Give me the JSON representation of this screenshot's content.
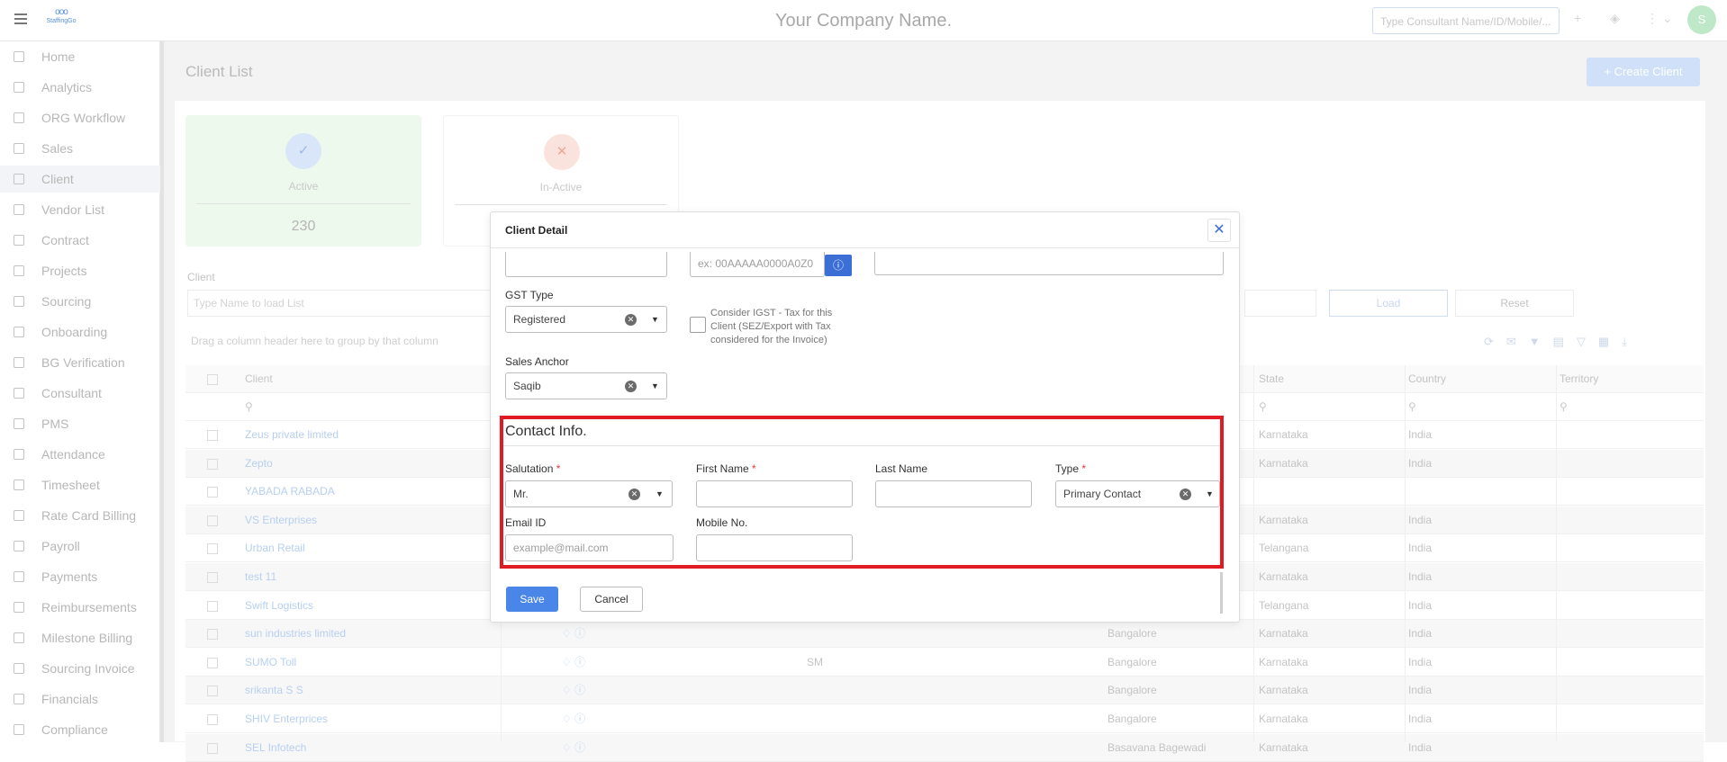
{
  "header": {
    "company_name": "Your Company Name.",
    "search_placeholder": "Type Consultant Name/ID/Mobile/...",
    "avatar_initial": "S",
    "logo_text": "StaffingGo"
  },
  "sidebar": {
    "items": [
      {
        "label": "Home"
      },
      {
        "label": "Analytics"
      },
      {
        "label": "ORG Workflow"
      },
      {
        "label": "Sales"
      },
      {
        "label": "Client"
      },
      {
        "label": "Vendor List"
      },
      {
        "label": "Contract"
      },
      {
        "label": "Projects"
      },
      {
        "label": "Sourcing"
      },
      {
        "label": "Onboarding"
      },
      {
        "label": "BG Verification"
      },
      {
        "label": "Consultant"
      },
      {
        "label": "PMS"
      },
      {
        "label": "Attendance"
      },
      {
        "label": "Timesheet"
      },
      {
        "label": "Rate Card Billing"
      },
      {
        "label": "Payroll"
      },
      {
        "label": "Payments"
      },
      {
        "label": "Reimbursements"
      },
      {
        "label": "Milestone Billing"
      },
      {
        "label": "Sourcing Invoice"
      },
      {
        "label": "Financials"
      },
      {
        "label": "Compliance"
      }
    ],
    "active": "Client"
  },
  "page": {
    "title": "Client List",
    "create_button": "+ Create Client",
    "active_card": {
      "label": "Active",
      "count": "230"
    },
    "inactive_card": {
      "label": "In-Active",
      "count": ""
    },
    "client_filter_label": "Client",
    "client_filter_placeholder": "Type Name to load List",
    "load_button": "Load",
    "reset_button": "Reset",
    "group_hint": "Drag a column header here to group by that column"
  },
  "grid": {
    "headers": {
      "client": "Client",
      "state": "State",
      "country": "Country",
      "territory": "Territory"
    },
    "rows": [
      {
        "client": "Zeus private limited",
        "code": "",
        "city": "",
        "state": "Karnataka",
        "country": "India"
      },
      {
        "client": "Zepto",
        "code": "",
        "city": "",
        "state": "Karnataka",
        "country": "India"
      },
      {
        "client": "YABADA RABADA",
        "code": "",
        "city": "",
        "state": "",
        "country": ""
      },
      {
        "client": "VS Enterprises",
        "code": "",
        "city": "",
        "state": "Karnataka",
        "country": "India"
      },
      {
        "client": "Urban Retail",
        "code": "",
        "city": "",
        "state": "Telangana",
        "country": "India"
      },
      {
        "client": "test 11",
        "code": "",
        "city": "",
        "state": "Karnataka",
        "country": "India"
      },
      {
        "client": "Swift Logistics",
        "code": "",
        "city": "",
        "state": "Telangana",
        "country": "India"
      },
      {
        "client": "sun industries limited",
        "code": "",
        "city": "Bangalore",
        "state": "Karnataka",
        "country": "India"
      },
      {
        "client": "SUMO Toll",
        "code": "SM",
        "city": "Bangalore",
        "state": "Karnataka",
        "country": "India"
      },
      {
        "client": "srikanta S S",
        "code": "",
        "city": "Bangalore",
        "state": "Karnataka",
        "country": "India"
      },
      {
        "client": "SHIV Enterprices",
        "code": "",
        "city": "Bangalore",
        "state": "Karnataka",
        "country": "India"
      },
      {
        "client": "SEL Infotech",
        "code": "",
        "city": "Basavana Bagewadi",
        "state": "Karnataka",
        "country": "India"
      }
    ]
  },
  "modal": {
    "title": "Client Detail",
    "gstin_placeholder": "ex: 00AAAAA0000A0Z0",
    "gst_type_label": "GST Type",
    "gst_type_value": "Registered",
    "igst_text": "Consider IGST - Tax for this Client (SEZ/Export with Tax considered for the Invoice)",
    "sales_anchor_label": "Sales Anchor",
    "sales_anchor_value": "Saqib",
    "contact_section_title": "Contact Info.",
    "salutation_label": "Salutation",
    "salutation_value": "Mr.",
    "first_name_label": "First Name",
    "first_name_value": "",
    "last_name_label": "Last Name",
    "last_name_value": "",
    "type_label": "Type",
    "type_value": "Primary Contact",
    "email_label": "Email ID",
    "email_placeholder": "example@mail.com",
    "mobile_label": "Mobile No.",
    "mobile_value": "",
    "required_mark": "*",
    "save_button": "Save",
    "cancel_button": "Cancel"
  },
  "colors": {
    "primary": "#4a86e8",
    "info_button": "#3b6fd6",
    "highlight_border": "#e01b24",
    "required": "#e53935",
    "active_card_bg": "#eef9ee"
  }
}
